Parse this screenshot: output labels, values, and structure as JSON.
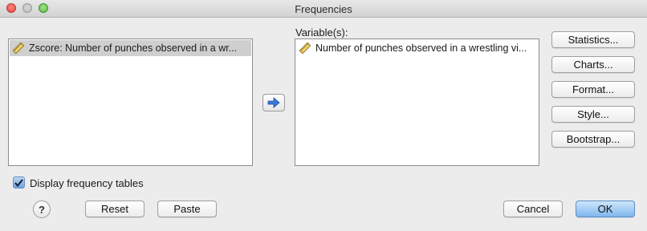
{
  "window": {
    "title": "Frequencies"
  },
  "source_list": {
    "items": [
      {
        "label": "Zscore:  Number of punches observed in a wr...",
        "icon": "ruler-scale-icon",
        "selected": true
      }
    ]
  },
  "target_list": {
    "label": "Variable(s):",
    "items": [
      {
        "label": "Number of punches observed in a wrestling vi...",
        "icon": "ruler-scale-icon"
      }
    ]
  },
  "move_button": {
    "icon": "arrow-right-icon"
  },
  "side_buttons": {
    "statistics": "Statistics...",
    "charts": "Charts...",
    "format": "Format...",
    "style": "Style...",
    "bootstrap": "Bootstrap..."
  },
  "options": {
    "display_frequency_tables": {
      "label": "Display frequency tables",
      "checked": true
    }
  },
  "footer": {
    "help": "?",
    "reset": "Reset",
    "paste": "Paste",
    "cancel": "Cancel",
    "ok": "OK"
  },
  "colors": {
    "accent": "#3b78d8",
    "selection": "#cfcfcf",
    "background": "#ececec"
  }
}
